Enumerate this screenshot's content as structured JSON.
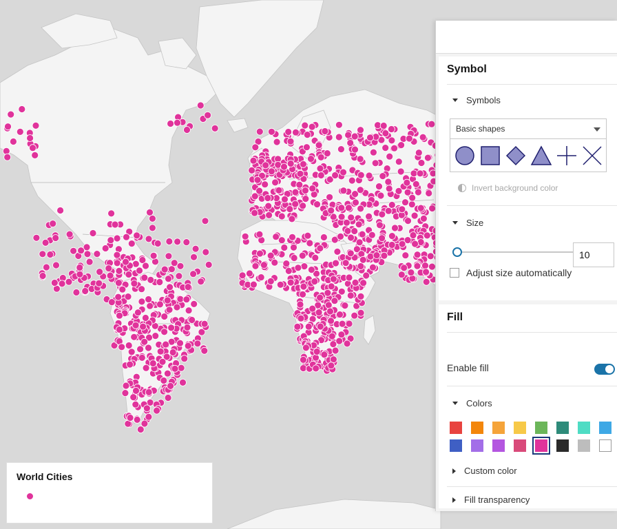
{
  "colors": {
    "ocean": "#d9d9d9",
    "land": "#f4f4f4",
    "border": "#b8b8b8",
    "point": "#e0339b",
    "accent": "#1a73a8"
  },
  "legend": {
    "title": "World Cities",
    "symbol_color": "#e0339b"
  },
  "symbol_panel": {
    "title": "Symbol",
    "symbols_header": "Symbols",
    "gallery_select": "Basic shapes",
    "shapes": [
      {
        "icon": "circle-icon"
      },
      {
        "icon": "square-icon"
      },
      {
        "icon": "diamond-icon"
      },
      {
        "icon": "triangle-icon"
      },
      {
        "icon": "plus-icon"
      },
      {
        "icon": "x-icon"
      }
    ],
    "invert_label": "Invert background color",
    "size_header": "Size",
    "size_value": "10",
    "size_slider_fraction": 0.02,
    "adjust_size_label": "Adjust size automatically",
    "adjust_size_checked": false
  },
  "fill_panel": {
    "title": "Fill",
    "enable_fill_label": "Enable fill",
    "enable_fill_on": true,
    "colors_header": "Colors",
    "swatches": [
      "#e8433f",
      "#f3860b",
      "#f5a43a",
      "#f7c948",
      "#6cb65a",
      "#2e8b7a",
      "#4fdcc4",
      "#3ea8e5",
      "#3f5fc4",
      "#a36ee8",
      "#b456e0",
      "#d94a7a",
      "#e0339b",
      "#2b2b2b",
      "#bdbdbd",
      "#ffffff"
    ],
    "selected_swatch_index": 12,
    "custom_color_label": "Custom color",
    "fill_transparency_label": "Fill transparency"
  }
}
